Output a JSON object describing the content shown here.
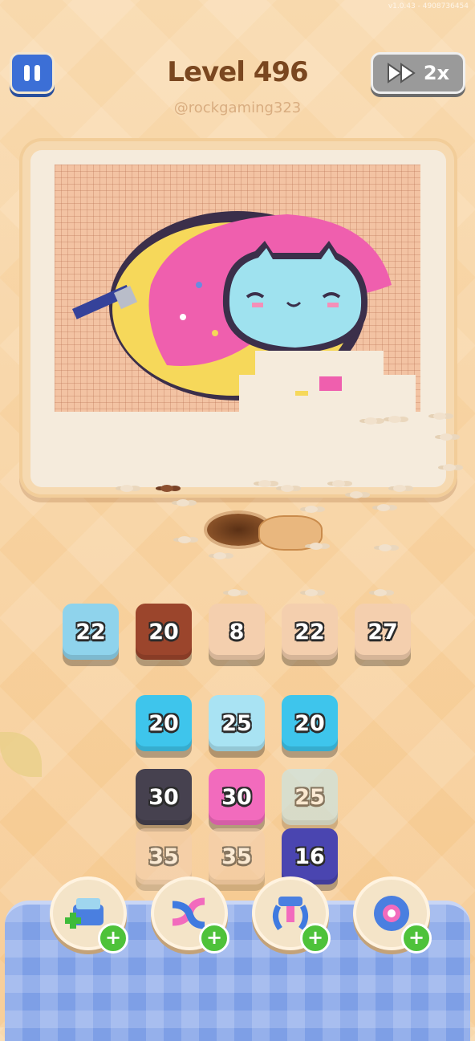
{
  "header": {
    "version": "v1.0.43 - 4908736454",
    "title": "Level 496",
    "handle": "@rockgaming323",
    "speed_label": "2x",
    "pause_icon": "pause-icon",
    "speed_icon": "fast-forward-icon"
  },
  "board": {
    "picture": "pixel art donut cat",
    "colors": {
      "outline": "#3b2f4a",
      "pink": "#ef5fae",
      "yellow": "#f6d85a",
      "cyan": "#9fe2ef",
      "navy": "#35429a",
      "bg": "#f3c3a3"
    }
  },
  "queue_row": {
    "tiles": [
      {
        "value": "22",
        "color": "#8fd3ec"
      },
      {
        "value": "20",
        "color": "#9b452c"
      },
      {
        "value": "8",
        "color": "#f4cfae"
      },
      {
        "value": "22",
        "color": "#f4cfae"
      },
      {
        "value": "27",
        "color": "#f4cfae"
      }
    ]
  },
  "stock_grid": {
    "rows": [
      [
        {
          "value": "20",
          "color": "#3ec5ec"
        },
        {
          "value": "25",
          "color": "#a9e3f3"
        },
        {
          "value": "20",
          "color": "#3ec5ec"
        }
      ],
      [
        {
          "value": "30",
          "color": "#46414f"
        },
        {
          "value": "30",
          "color": "#f26bbd"
        },
        {
          "value": "25",
          "color": "#bfe8f2"
        }
      ],
      [
        {
          "value": "35",
          "color": "#f4cfae"
        },
        {
          "value": "35",
          "color": "#f4cfae"
        },
        {
          "value": "16",
          "color": "#4a45b0"
        }
      ]
    ]
  },
  "boosters": [
    {
      "name": "add-slot",
      "icon": "add-tray-icon"
    },
    {
      "name": "shuffle",
      "icon": "shuffle-arrows-icon"
    },
    {
      "name": "magnet",
      "icon": "claw-icon"
    },
    {
      "name": "undo",
      "icon": "flower-gear-icon"
    }
  ]
}
